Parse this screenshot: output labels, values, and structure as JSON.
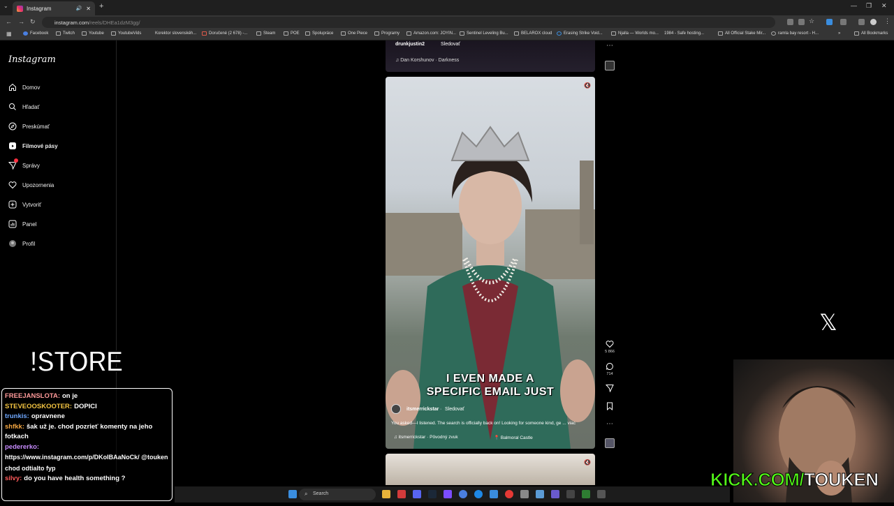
{
  "browser": {
    "tab_title": "Instagram",
    "url_host": "instagram.com",
    "url_path": "/reels/DHEa1dzM3gg/",
    "bookmarks": [
      "Facebook",
      "Twitch",
      "Youtube",
      "YoutubeVids",
      "Korektor slovenskéh...",
      "Doručené (2 678) -...",
      "Steam",
      "POE",
      "Spolupráce",
      "One Piece",
      "Programy",
      "Amazon.com: JOYIN...",
      "Sentinel Leveling Bu...",
      "BELAROX cloud",
      "Erasing Strike Void...",
      "Njalla — Worlds mo...",
      "1984 - Safe hosting...",
      "All Official Stake Mir...",
      "ramla bay resort - H..."
    ],
    "all_bookmarks": "All Bookmarks"
  },
  "instagram": {
    "logo": "Instagram",
    "nav": [
      {
        "label": "Domov",
        "icon": "home-icon"
      },
      {
        "label": "Hľadať",
        "icon": "search-icon"
      },
      {
        "label": "Preskúmať",
        "icon": "compass-icon"
      },
      {
        "label": "Filmové pásy",
        "icon": "reels-icon"
      },
      {
        "label": "Správy",
        "icon": "messages-icon"
      },
      {
        "label": "Upozornenia",
        "icon": "heart-icon"
      },
      {
        "label": "Vytvoriť",
        "icon": "plus-icon"
      },
      {
        "label": "Panel",
        "icon": "dashboard-icon"
      },
      {
        "label": "Profil",
        "icon": "avatar"
      }
    ],
    "prev_reel": {
      "user": "drunkjustin2",
      "follow": "Sledovať",
      "audio": "Dan Korshunov · Darkness"
    },
    "reel": {
      "overlay_caption_1": "I EVEN MADE A",
      "overlay_caption_2": "SPECIFIC EMAIL JUST",
      "user": "itsmerrickstar",
      "follow": "Sledovať",
      "description": "You asked—I listened. The search is officially back on! Looking for someone kind, ge ... viac",
      "audio": "itsmerrickstar · Pôvodný zvuk",
      "location": "Balmoral Castle"
    },
    "actions": {
      "likes": "5 866",
      "comments": "714"
    }
  },
  "stream": {
    "store": "!STORE",
    "kick_green": "KICK.COM/",
    "kick_white": "TOUKEN",
    "x_logo": "𝕏",
    "chat": [
      {
        "user": "FREEJANSLOTA:",
        "text": "on je",
        "color": "#ff9a9a"
      },
      {
        "user": "STEVEOOSKOOTER:",
        "text": "DOPICI",
        "color": "#f5c542"
      },
      {
        "user": "trunkis:",
        "text": "opravnene",
        "color": "#6fa8ff"
      },
      {
        "user": "shfkk:",
        "text": "šak už je. chod pozrieť komenty na jeho fotkach",
        "color": "#f5a742"
      },
      {
        "user": "pedererko:",
        "text": "https://www.instagram.com/p/DKoIBAaNoCk/ @touken chod odtialto fyp",
        "color": "#c88cff"
      },
      {
        "user": "silvy:",
        "text": "do you have health something ?",
        "color": "#ff5a5a"
      }
    ]
  },
  "taskbar": {
    "search": "Search"
  }
}
